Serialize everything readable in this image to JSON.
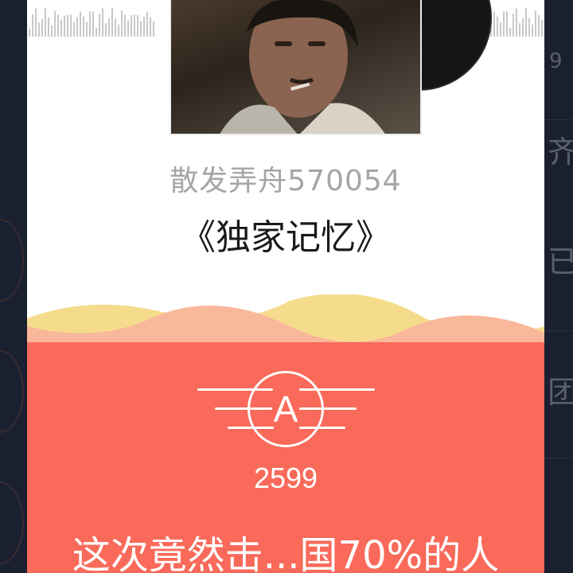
{
  "song": {
    "artist": "散发弄舟570054",
    "title": "《独家记忆》"
  },
  "result": {
    "grade": "A",
    "score": "2599",
    "summary": "这次竟然击...国70%的人"
  },
  "background": {
    "partial_chars": [
      "9",
      "齐",
      "已",
      "团"
    ]
  },
  "colors": {
    "accent_red": "#f96a5a",
    "wave_yellow": "#f5dc8c",
    "wave_peach": "#f9b89a",
    "card_bg": "#ffffff",
    "muted_text": "#a5a5a5"
  },
  "icons": [
    "album-cover-image",
    "vinyl-disc-icon",
    "audio-wave-icon",
    "grade-badge-icon"
  ]
}
